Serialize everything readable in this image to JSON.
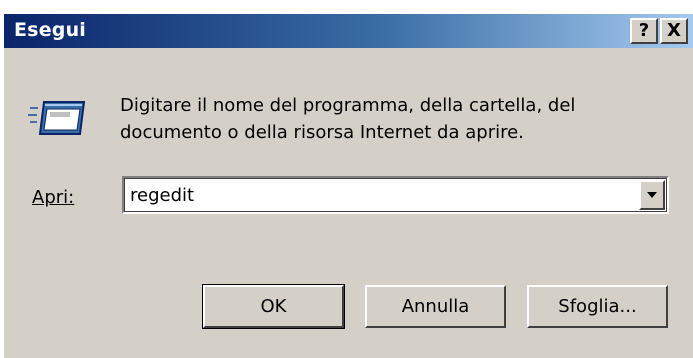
{
  "window": {
    "title": "Esegui",
    "help_button": "?",
    "close_button": "X"
  },
  "icon": "run-dialog-icon",
  "description": {
    "line1": "Digitare il nome del programma, della cartella, del",
    "line2": "documento o della risorsa Internet da aprire."
  },
  "open_field": {
    "label": "Apri:",
    "value": "regedit"
  },
  "buttons": {
    "ok": "OK",
    "cancel": "Annulla",
    "browse": "Sfoglia..."
  },
  "colors": {
    "titlebar_start": "#0a246a",
    "titlebar_end": "#a6caf0",
    "dialog_face": "#d4d0c8"
  }
}
